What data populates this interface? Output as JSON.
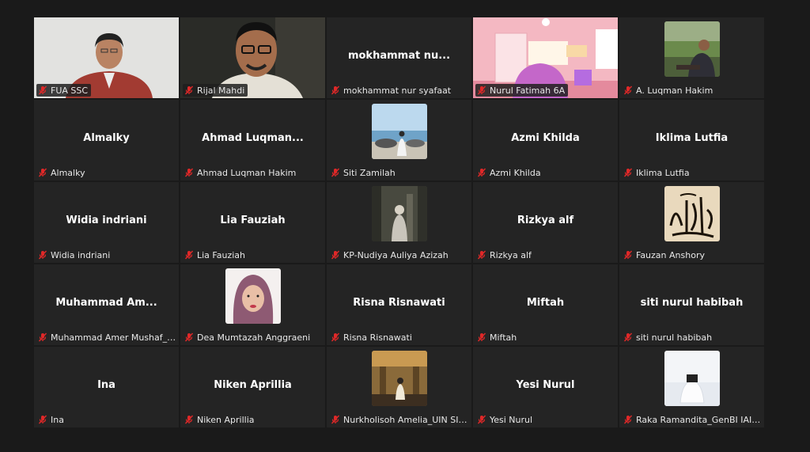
{
  "colors": {
    "active_border": "#23d959",
    "mic_muted": "#e02828",
    "tile_bg": "#242424",
    "page_bg": "#1a1a1a"
  },
  "participants": [
    {
      "display": "",
      "label": "FUA SSC",
      "type": "video-man-office",
      "active": true
    },
    {
      "display": "",
      "label": "Rijal Mahdi",
      "type": "video-man-glasses"
    },
    {
      "display": "mokhammat  nu...",
      "label": "mokhammat nur syafaat",
      "type": "name"
    },
    {
      "display": "",
      "label": "Nurul Fatimah 6A",
      "type": "video-pink-room"
    },
    {
      "display": "",
      "label": "A. Luqman Hakim",
      "type": "avatar-outdoor"
    },
    {
      "display": "Almalky",
      "label": "Almalky",
      "type": "name"
    },
    {
      "display": "Ahmad  Luqman...",
      "label": "Ahmad Luqman Hakim",
      "type": "name"
    },
    {
      "display": "",
      "label": "Siti Zamilah",
      "type": "avatar-beach"
    },
    {
      "display": "Azmi Khilda",
      "label": "Azmi Khilda",
      "type": "name"
    },
    {
      "display": "Iklima Lutfia",
      "label": "Iklima Lutfia",
      "type": "name"
    },
    {
      "display": "Widia indriani",
      "label": "Widia indriani",
      "type": "name"
    },
    {
      "display": "Lia Fauziah",
      "label": "Lia Fauziah",
      "type": "name"
    },
    {
      "display": "",
      "label": "KP-Nudiya Auliya Azizah",
      "type": "avatar-forest"
    },
    {
      "display": "Rizkya alf",
      "label": "Rizkya alf",
      "type": "name"
    },
    {
      "display": "",
      "label": "Fauzan Anshory",
      "type": "avatar-calligraphy"
    },
    {
      "display": "Muhammad  Am...",
      "label": "Muhammad Amer Mushaf_BS...",
      "type": "name"
    },
    {
      "display": "",
      "label": "Dea Mumtazah Anggraeni",
      "type": "avatar-hijab"
    },
    {
      "display": "Risna Risnawati",
      "label": "Risna Risnawati",
      "type": "name"
    },
    {
      "display": "Miftah",
      "label": "Miftah",
      "type": "name"
    },
    {
      "display": "siti nurul habibah",
      "label": "siti nurul habibah",
      "type": "name"
    },
    {
      "display": "Ina",
      "label": "Ina",
      "type": "name"
    },
    {
      "display": "Niken Aprillia",
      "label": "Niken Aprillia",
      "type": "name"
    },
    {
      "display": "",
      "label": "Nurkholisoh Amelia_UIN SIBE...",
      "type": "avatar-hall"
    },
    {
      "display": "Yesi Nurul",
      "label": "Yesi Nurul",
      "type": "name"
    },
    {
      "display": "",
      "label": "Raka Ramandita_GenBI IAIN C...",
      "type": "avatar-white"
    }
  ]
}
